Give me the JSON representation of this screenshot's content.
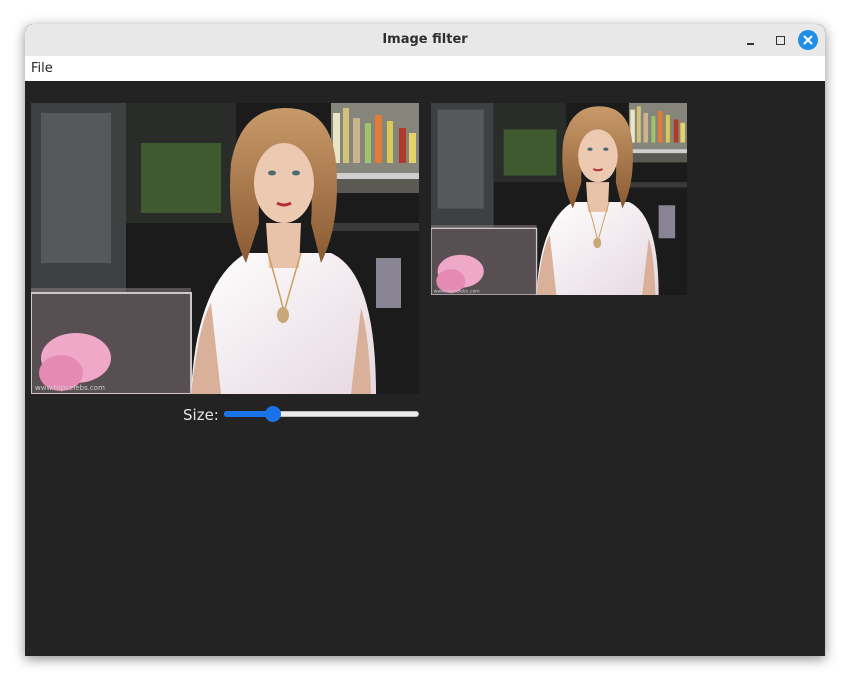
{
  "window": {
    "title": "Image filter"
  },
  "menu": {
    "file_label": "File"
  },
  "images": {
    "watermark_text": "www.topcelebs.com"
  },
  "controls": {
    "size_label": "Size:",
    "size_value": 0.23
  },
  "colors": {
    "accent": "#1a73e8",
    "close_button": "#1e8ee6",
    "background": "#232323"
  },
  "icons": {
    "minimize": "minimize-icon",
    "maximize": "maximize-icon",
    "close": "close-icon"
  }
}
